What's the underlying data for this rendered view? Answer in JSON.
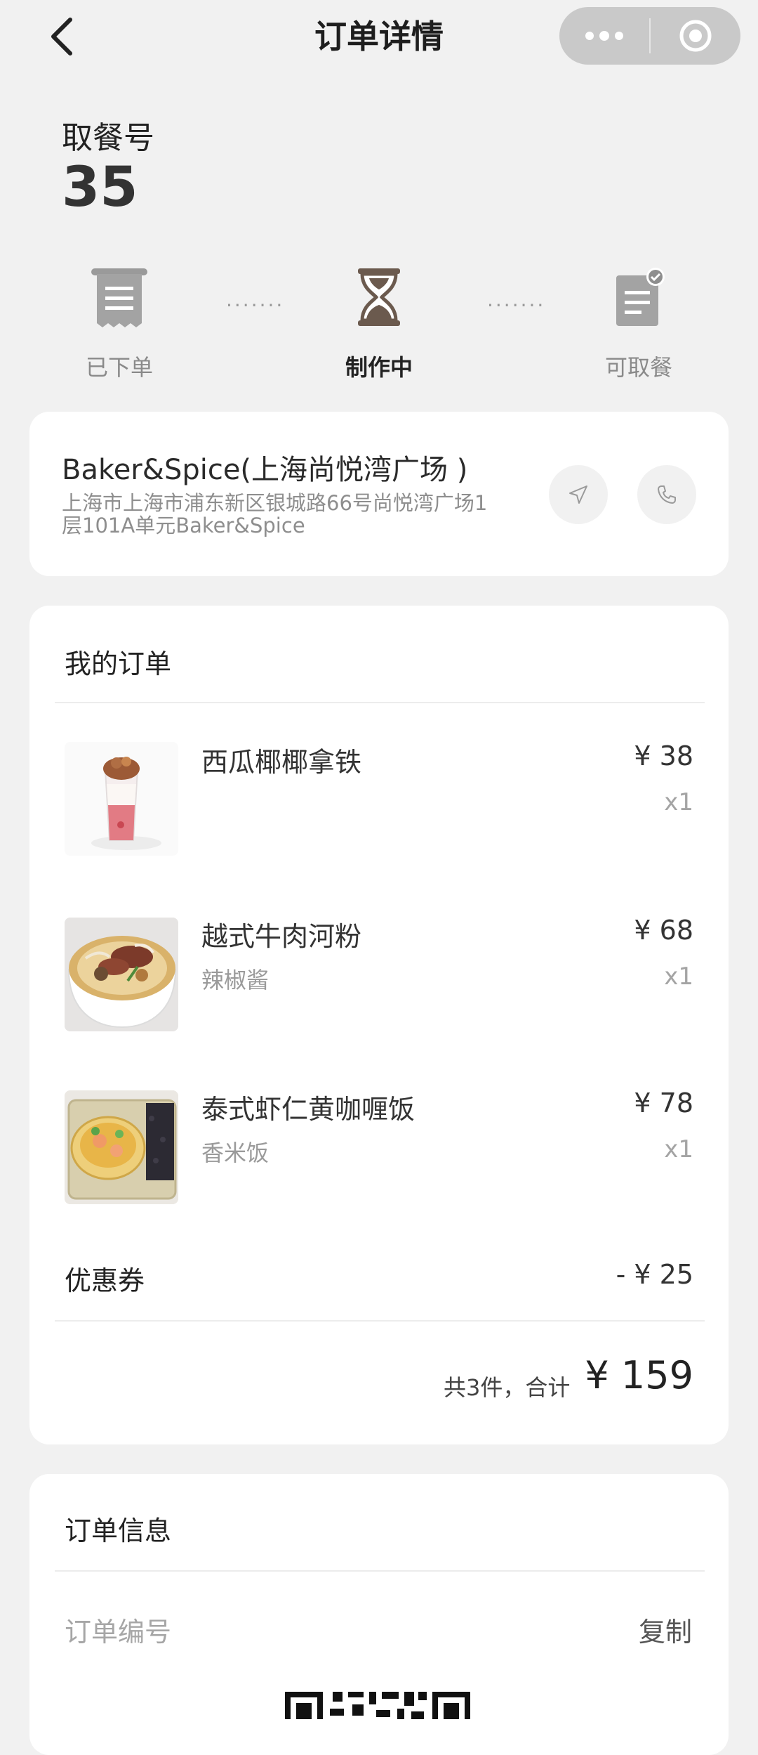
{
  "header": {
    "title": "订单详情",
    "back_icon": "chevron-left-icon",
    "more_icon": "more-dots-icon",
    "close_icon": "target-circle-icon"
  },
  "pickup": {
    "label": "取餐号",
    "number": "35"
  },
  "steps": [
    {
      "label": "已下单",
      "icon": "receipt-icon",
      "active": false
    },
    {
      "label": "制作中",
      "icon": "hourglass-icon",
      "active": true
    },
    {
      "label": "可取餐",
      "icon": "document-check-icon",
      "active": false
    }
  ],
  "step_dots": "·······",
  "store": {
    "name": "Baker&Spice(上海尚悦湾广场 )",
    "address_line1": "上海市上海市浦东新区银城路66号尚悦湾广场1",
    "address_line2": "层101A单元Baker&Spice",
    "nav_icon": "navigation-arrow-icon",
    "phone_icon": "phone-icon"
  },
  "order": {
    "title": "我的订单",
    "items": [
      {
        "name": "西瓜椰椰拿铁",
        "option": "",
        "price": "¥ 38",
        "qty": "x1",
        "image": "watermelon-latte-image"
      },
      {
        "name": "越式牛肉河粉",
        "option": "辣椒酱",
        "price": "¥ 68",
        "qty": "x1",
        "image": "beef-pho-image"
      },
      {
        "name": "泰式虾仁黄咖喱饭",
        "option": "香米饭",
        "price": "¥ 78",
        "qty": "x1",
        "image": "shrimp-curry-rice-image"
      }
    ],
    "coupon_label": "优惠券",
    "coupon_value": "- ¥ 25",
    "total_count": "共3件，合计",
    "total_value": "¥ 159"
  },
  "order_info": {
    "title": "订单信息",
    "order_no_label": "订单编号",
    "copy_label": "复制"
  },
  "colors": {
    "background": "#f1f1f1",
    "card": "#ffffff",
    "accent_brown": "#6b5a4e",
    "muted": "#9a9a9a"
  }
}
